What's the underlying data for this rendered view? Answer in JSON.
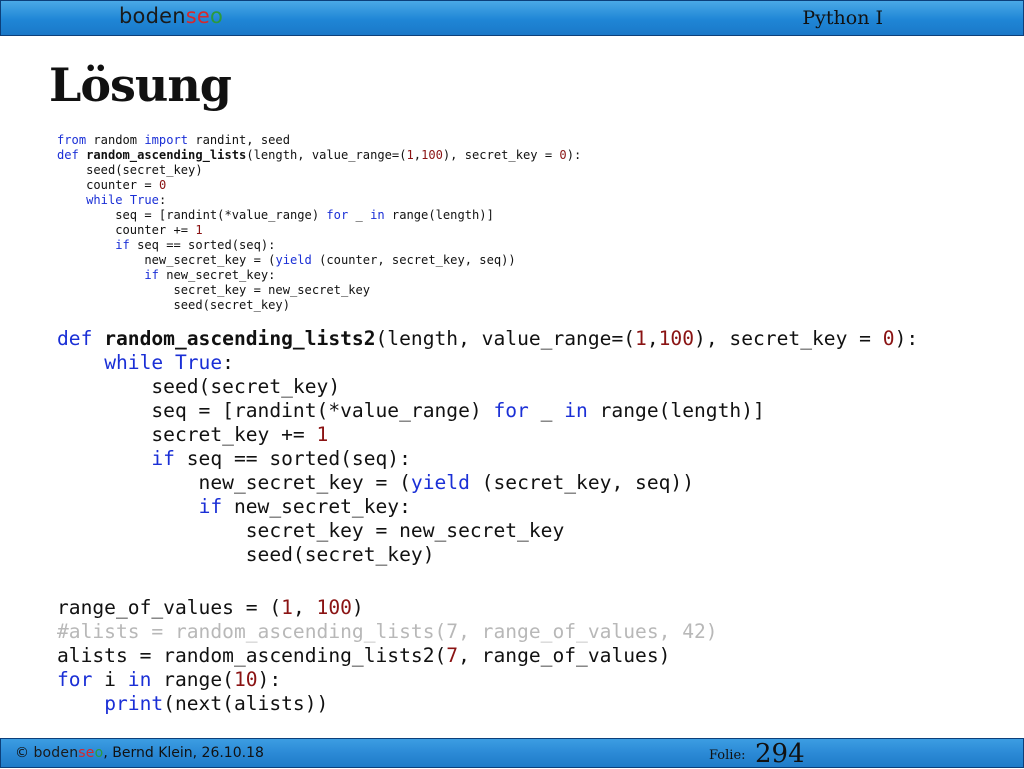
{
  "header": {
    "logo": {
      "part1": "boden",
      "part2": "se",
      "part3": "o"
    },
    "course_title": "Python I"
  },
  "slide": {
    "title": "Lösung"
  },
  "code_small": [
    [
      {
        "t": "from",
        "c": "kw"
      },
      {
        "t": " random "
      },
      {
        "t": "import",
        "c": "kw"
      },
      {
        "t": " randint, seed"
      }
    ],
    [
      {
        "t": "def",
        "c": "kw"
      },
      {
        "t": " "
      },
      {
        "t": "random_ascending_lists",
        "c": "fn"
      },
      {
        "t": "(length, value_range=("
      },
      {
        "t": "1",
        "c": "num"
      },
      {
        "t": ","
      },
      {
        "t": "100",
        "c": "num"
      },
      {
        "t": "), secret_key = "
      },
      {
        "t": "0",
        "c": "num"
      },
      {
        "t": "):"
      }
    ],
    [
      {
        "t": "    seed(secret_key)"
      }
    ],
    [
      {
        "t": "    counter = "
      },
      {
        "t": "0",
        "c": "num"
      }
    ],
    [
      {
        "t": "    "
      },
      {
        "t": "while",
        "c": "kw"
      },
      {
        "t": " "
      },
      {
        "t": "True",
        "c": "kw"
      },
      {
        "t": ":"
      }
    ],
    [
      {
        "t": "        seq = [randint(*value_range) "
      },
      {
        "t": "for",
        "c": "kw"
      },
      {
        "t": " _ "
      },
      {
        "t": "in",
        "c": "kw"
      },
      {
        "t": " range(length)]"
      }
    ],
    [
      {
        "t": "        counter += "
      },
      {
        "t": "1",
        "c": "num"
      }
    ],
    [
      {
        "t": "        "
      },
      {
        "t": "if",
        "c": "kw"
      },
      {
        "t": " seq == sorted(seq):"
      }
    ],
    [
      {
        "t": "            new_secret_key = ("
      },
      {
        "t": "yield",
        "c": "kw"
      },
      {
        "t": " (counter, secret_key, seq))"
      }
    ],
    [
      {
        "t": "            "
      },
      {
        "t": "if",
        "c": "kw"
      },
      {
        "t": " new_secret_key:"
      }
    ],
    [
      {
        "t": "                secret_key = new_secret_key"
      }
    ],
    [
      {
        "t": "                seed(secret_key)"
      }
    ]
  ],
  "code_large": [
    [
      {
        "t": "def",
        "c": "kw"
      },
      {
        "t": " "
      },
      {
        "t": "random_ascending_lists2",
        "c": "fn"
      },
      {
        "t": "(length, value_range=("
      },
      {
        "t": "1",
        "c": "num"
      },
      {
        "t": ","
      },
      {
        "t": "100",
        "c": "num"
      },
      {
        "t": "), secret_key = "
      },
      {
        "t": "0",
        "c": "num"
      },
      {
        "t": "):"
      }
    ],
    [
      {
        "t": "    "
      },
      {
        "t": "while",
        "c": "kw"
      },
      {
        "t": " "
      },
      {
        "t": "True",
        "c": "kw"
      },
      {
        "t": ":"
      }
    ],
    [
      {
        "t": "        seed(secret_key)"
      }
    ],
    [
      {
        "t": "        seq = [randint(*value_range) "
      },
      {
        "t": "for",
        "c": "kw"
      },
      {
        "t": " _ "
      },
      {
        "t": "in",
        "c": "kw"
      },
      {
        "t": " range(length)]"
      }
    ],
    [
      {
        "t": "        secret_key += "
      },
      {
        "t": "1",
        "c": "num"
      }
    ],
    [
      {
        "t": "        "
      },
      {
        "t": "if",
        "c": "kw"
      },
      {
        "t": " seq == sorted(seq):"
      }
    ],
    [
      {
        "t": "            new_secret_key = ("
      },
      {
        "t": "yield",
        "c": "kw"
      },
      {
        "t": " (secret_key, seq))"
      }
    ],
    [
      {
        "t": "            "
      },
      {
        "t": "if",
        "c": "kw"
      },
      {
        "t": " new_secret_key:"
      }
    ],
    [
      {
        "t": "                secret_key = new_secret_key"
      }
    ],
    [
      {
        "t": "                seed(secret_key)"
      }
    ]
  ],
  "code_bottom": [
    [
      {
        "t": "range_of_values = ("
      },
      {
        "t": "1",
        "c": "num"
      },
      {
        "t": ", "
      },
      {
        "t": "100",
        "c": "num"
      },
      {
        "t": ")"
      }
    ],
    [
      {
        "t": "#alists = random_ascending_lists(7, range_of_values, 42)",
        "c": "cmt"
      }
    ],
    [
      {
        "t": "alists = random_ascending_lists2("
      },
      {
        "t": "7",
        "c": "num"
      },
      {
        "t": ", range_of_values)"
      }
    ],
    [
      {
        "t": "for",
        "c": "kw"
      },
      {
        "t": " i "
      },
      {
        "t": "in",
        "c": "kw"
      },
      {
        "t": " range("
      },
      {
        "t": "10",
        "c": "num"
      },
      {
        "t": "):"
      }
    ],
    [
      {
        "t": "    "
      },
      {
        "t": "print",
        "c": "kw"
      },
      {
        "t": "(next(alists))"
      }
    ]
  ],
  "footer": {
    "copyright": "© ",
    "author_date": ", Bernd Klein, 26.10.18",
    "folie_label": "Folie:",
    "slide_number": "294"
  }
}
